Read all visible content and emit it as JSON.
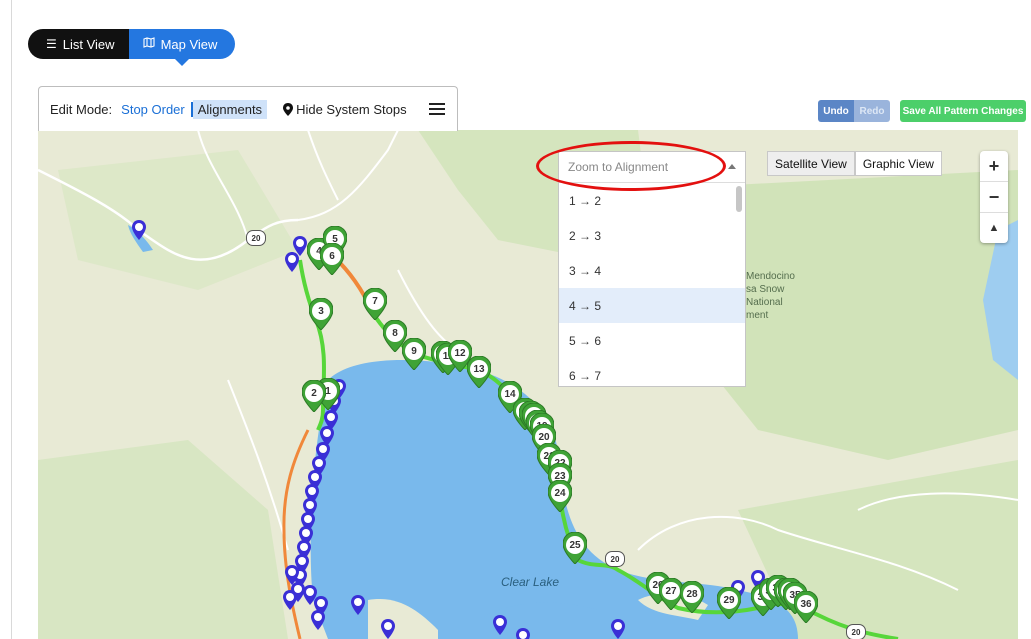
{
  "view_toggle": {
    "list_label": "List View",
    "map_label": "Map View",
    "active": "map"
  },
  "edit_panel": {
    "edit_mode_label": "Edit Mode:",
    "stop_order_label": "Stop Order",
    "alignments_label": "Alignments",
    "hide_stops_label": "Hide System Stops"
  },
  "actions": {
    "undo_label": "Undo",
    "redo_label": "Redo",
    "save_label": "Save All Pattern Changes"
  },
  "map": {
    "satellite_label": "Satellite View",
    "graphic_label": "Graphic View",
    "zoom_in": "+",
    "zoom_out": "−",
    "compass": "▲",
    "lake_label": "Clear Lake",
    "terrain_label": "Mendocino\nsa Snow\nNational\nment",
    "route_shield_1": "20",
    "route_shield_2": "20",
    "route_shield_3": "20",
    "route_color": "#57d63a",
    "accent_orange": "#f0883a",
    "stop_color": "#3fa336",
    "system_stop_color": "#3a2fd6"
  },
  "alignment_dropdown": {
    "placeholder": "Zoom to Alignment",
    "options": [
      "1 → 2",
      "2 → 3",
      "3 → 4",
      "4 → 5",
      "5 → 6",
      "6 → 7"
    ],
    "highlighted_index": 3
  },
  "stops": [
    "1",
    "2",
    "3",
    "4",
    "5",
    "6",
    "7",
    "8",
    "9",
    "10",
    "11",
    "12",
    "13",
    "14",
    "15",
    "16",
    "17",
    "18",
    "19",
    "20",
    "21",
    "22",
    "23",
    "24",
    "25",
    "26",
    "27",
    "28",
    "29",
    "30",
    "31",
    "32",
    "33",
    "34",
    "35",
    "36"
  ]
}
